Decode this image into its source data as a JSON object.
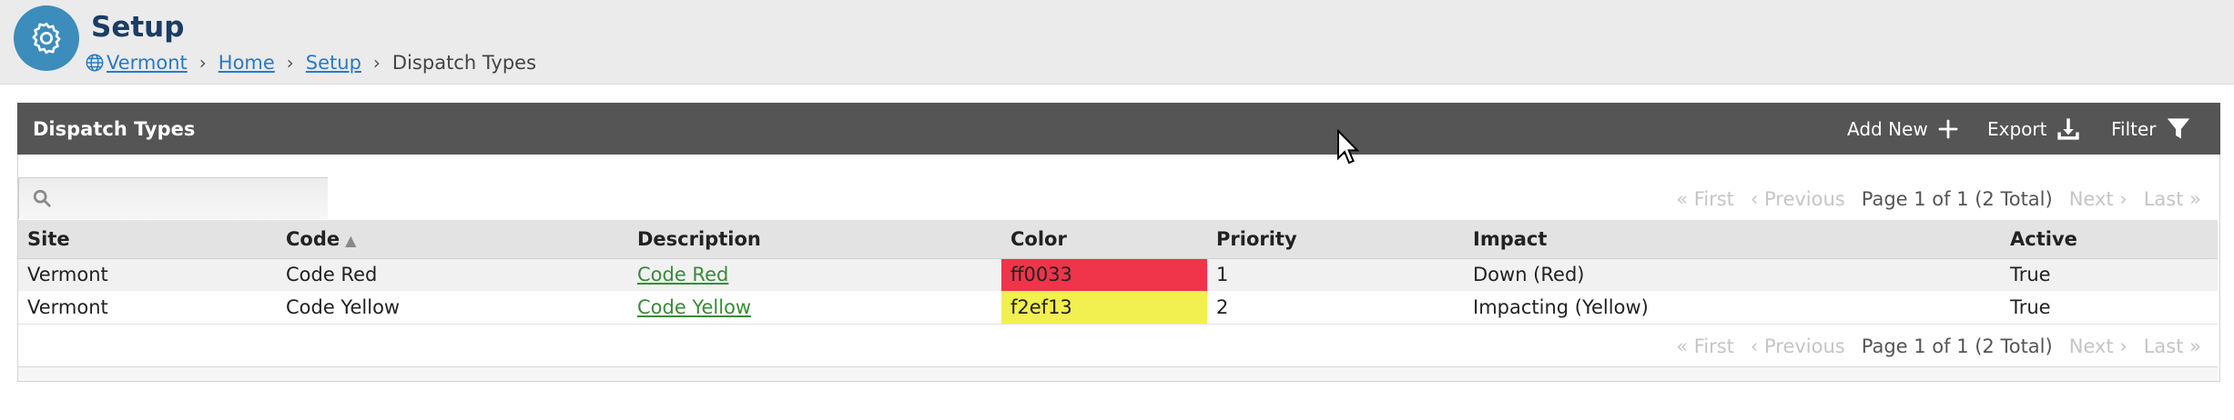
{
  "header": {
    "title": "Setup",
    "breadcrumb": {
      "site": "Vermont",
      "home": "Home",
      "setup": "Setup",
      "current": "Dispatch Types"
    }
  },
  "panel": {
    "title": "Dispatch Types",
    "add_new_label": "Add New",
    "export_label": "Export",
    "filter_label": "Filter"
  },
  "search": {
    "placeholder": ""
  },
  "pager": {
    "first": "« First",
    "previous": "‹ Previous",
    "info": "Page 1 of 1 (2 Total)",
    "next": "Next ›",
    "last": "Last »"
  },
  "table": {
    "columns": {
      "site": "Site",
      "code": "Code",
      "description": "Description",
      "color": "Color",
      "priority": "Priority",
      "impact": "Impact",
      "active": "Active"
    },
    "rows": [
      {
        "site": "Vermont",
        "code": "Code Red",
        "description": "Code Red",
        "color": "ff0033",
        "color_hex": "#f0344a",
        "priority": "1",
        "impact": "Down (Red)",
        "active": "True"
      },
      {
        "site": "Vermont",
        "code": "Code Yellow",
        "description": "Code Yellow",
        "color": "f2ef13",
        "color_hex": "#f2ef50",
        "priority": "2",
        "impact": "Impacting (Yellow)",
        "active": "True"
      }
    ]
  },
  "colors": {
    "header_bar": "#555555",
    "accent": "#3c8dbc",
    "title": "#1a3c64",
    "link": "#2a7ac0",
    "description_link": "#3a8a3a"
  }
}
